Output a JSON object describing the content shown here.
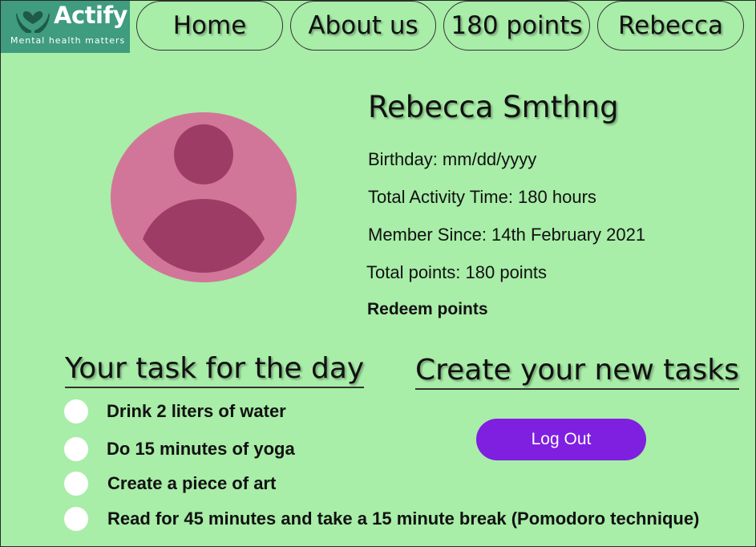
{
  "brand": {
    "name": "Actify",
    "tagline": "Mental health matters",
    "logo_color": "#3f9c7e"
  },
  "nav": {
    "home": "Home",
    "about": "About us",
    "points": "180 points",
    "user": "Rebecca"
  },
  "profile": {
    "name": "Rebecca Smthng",
    "birthday": "Birthday: mm/dd/yyyy",
    "activity_time": "Total Activity Time: 180 hours",
    "member_since": "Member Since: 14th February 2021",
    "total_points": "Total points: 180 points",
    "redeem": "Redeem points",
    "avatar_icon": "user-avatar-icon"
  },
  "tasks": {
    "title": "Your task for the day",
    "items": [
      "Drink 2 liters of water",
      "Do  15 minutes of yoga",
      "Create a piece of art",
      "Read for 45 minutes and take a 15 minute break (Pomodoro technique)"
    ]
  },
  "create": {
    "title": "Create your new tasks"
  },
  "logout": {
    "label": "Log Out",
    "color": "#7f1fe0"
  },
  "colors": {
    "background": "#a8eda8",
    "avatar_bg": "#d27699",
    "avatar_fg": "#9d3d66"
  }
}
